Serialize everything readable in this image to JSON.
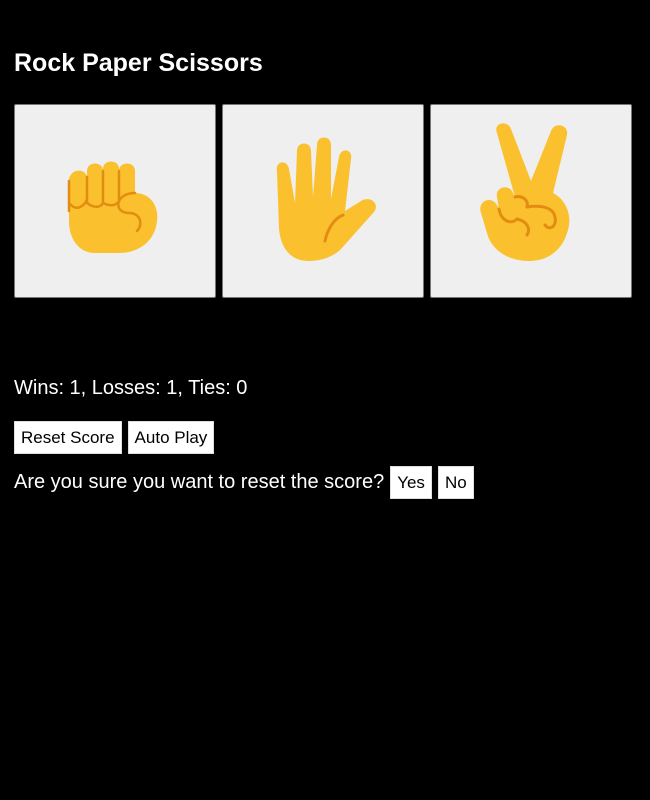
{
  "app": {
    "title": "Rock Paper Scissors"
  },
  "moves": [
    {
      "name": "rock",
      "icon": "fist-icon"
    },
    {
      "name": "paper",
      "icon": "raised-hand-icon"
    },
    {
      "name": "scissors",
      "icon": "victory-hand-icon"
    }
  ],
  "score": {
    "text": "Wins: 1, Losses: 1, Ties: 0"
  },
  "controls": {
    "reset_label": "Reset Score",
    "autoplay_label": "Auto Play"
  },
  "confirm": {
    "question": "Are you sure you want to reset the score?",
    "yes_label": "Yes",
    "no_label": "No"
  },
  "colors": {
    "background": "#000000",
    "move_button_bg": "#efefef",
    "hand_skin": "#fbc02d",
    "hand_line": "#e28d12",
    "text": "#ffffff"
  }
}
